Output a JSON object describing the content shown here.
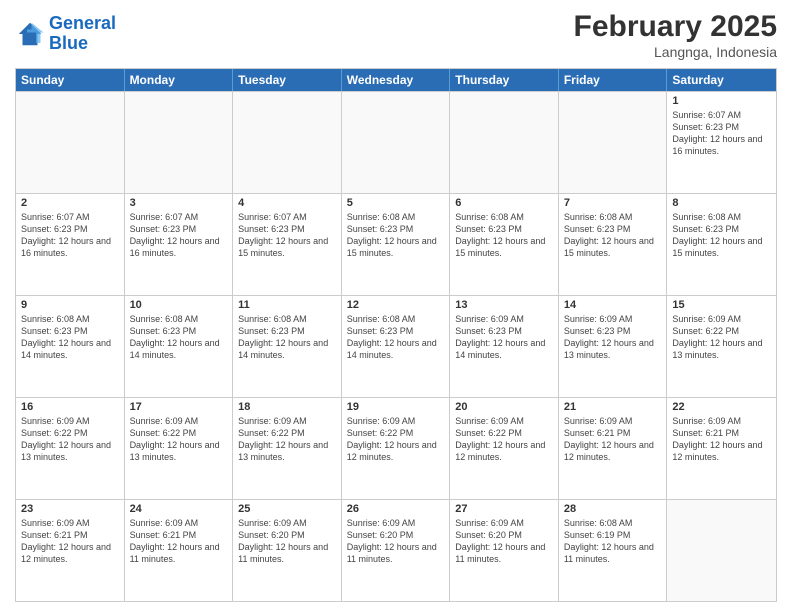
{
  "logo": {
    "line1": "General",
    "line2": "Blue"
  },
  "title": "February 2025",
  "location": "Langnga, Indonesia",
  "day_headers": [
    "Sunday",
    "Monday",
    "Tuesday",
    "Wednesday",
    "Thursday",
    "Friday",
    "Saturday"
  ],
  "weeks": [
    [
      {
        "day": null
      },
      {
        "day": null
      },
      {
        "day": null
      },
      {
        "day": null
      },
      {
        "day": null
      },
      {
        "day": null
      },
      {
        "day": "1",
        "sunrise": "6:07 AM",
        "sunset": "6:23 PM",
        "daylight": "12 hours and 16 minutes."
      }
    ],
    [
      {
        "day": "2",
        "sunrise": "6:07 AM",
        "sunset": "6:23 PM",
        "daylight": "12 hours and 16 minutes."
      },
      {
        "day": "3",
        "sunrise": "6:07 AM",
        "sunset": "6:23 PM",
        "daylight": "12 hours and 16 minutes."
      },
      {
        "day": "4",
        "sunrise": "6:07 AM",
        "sunset": "6:23 PM",
        "daylight": "12 hours and 15 minutes."
      },
      {
        "day": "5",
        "sunrise": "6:08 AM",
        "sunset": "6:23 PM",
        "daylight": "12 hours and 15 minutes."
      },
      {
        "day": "6",
        "sunrise": "6:08 AM",
        "sunset": "6:23 PM",
        "daylight": "12 hours and 15 minutes."
      },
      {
        "day": "7",
        "sunrise": "6:08 AM",
        "sunset": "6:23 PM",
        "daylight": "12 hours and 15 minutes."
      },
      {
        "day": "8",
        "sunrise": "6:08 AM",
        "sunset": "6:23 PM",
        "daylight": "12 hours and 15 minutes."
      }
    ],
    [
      {
        "day": "9",
        "sunrise": "6:08 AM",
        "sunset": "6:23 PM",
        "daylight": "12 hours and 14 minutes."
      },
      {
        "day": "10",
        "sunrise": "6:08 AM",
        "sunset": "6:23 PM",
        "daylight": "12 hours and 14 minutes."
      },
      {
        "day": "11",
        "sunrise": "6:08 AM",
        "sunset": "6:23 PM",
        "daylight": "12 hours and 14 minutes."
      },
      {
        "day": "12",
        "sunrise": "6:08 AM",
        "sunset": "6:23 PM",
        "daylight": "12 hours and 14 minutes."
      },
      {
        "day": "13",
        "sunrise": "6:09 AM",
        "sunset": "6:23 PM",
        "daylight": "12 hours and 14 minutes."
      },
      {
        "day": "14",
        "sunrise": "6:09 AM",
        "sunset": "6:23 PM",
        "daylight": "12 hours and 13 minutes."
      },
      {
        "day": "15",
        "sunrise": "6:09 AM",
        "sunset": "6:22 PM",
        "daylight": "12 hours and 13 minutes."
      }
    ],
    [
      {
        "day": "16",
        "sunrise": "6:09 AM",
        "sunset": "6:22 PM",
        "daylight": "12 hours and 13 minutes."
      },
      {
        "day": "17",
        "sunrise": "6:09 AM",
        "sunset": "6:22 PM",
        "daylight": "12 hours and 13 minutes."
      },
      {
        "day": "18",
        "sunrise": "6:09 AM",
        "sunset": "6:22 PM",
        "daylight": "12 hours and 13 minutes."
      },
      {
        "day": "19",
        "sunrise": "6:09 AM",
        "sunset": "6:22 PM",
        "daylight": "12 hours and 12 minutes."
      },
      {
        "day": "20",
        "sunrise": "6:09 AM",
        "sunset": "6:22 PM",
        "daylight": "12 hours and 12 minutes."
      },
      {
        "day": "21",
        "sunrise": "6:09 AM",
        "sunset": "6:21 PM",
        "daylight": "12 hours and 12 minutes."
      },
      {
        "day": "22",
        "sunrise": "6:09 AM",
        "sunset": "6:21 PM",
        "daylight": "12 hours and 12 minutes."
      }
    ],
    [
      {
        "day": "23",
        "sunrise": "6:09 AM",
        "sunset": "6:21 PM",
        "daylight": "12 hours and 12 minutes."
      },
      {
        "day": "24",
        "sunrise": "6:09 AM",
        "sunset": "6:21 PM",
        "daylight": "12 hours and 11 minutes."
      },
      {
        "day": "25",
        "sunrise": "6:09 AM",
        "sunset": "6:20 PM",
        "daylight": "12 hours and 11 minutes."
      },
      {
        "day": "26",
        "sunrise": "6:09 AM",
        "sunset": "6:20 PM",
        "daylight": "12 hours and 11 minutes."
      },
      {
        "day": "27",
        "sunrise": "6:09 AM",
        "sunset": "6:20 PM",
        "daylight": "12 hours and 11 minutes."
      },
      {
        "day": "28",
        "sunrise": "6:08 AM",
        "sunset": "6:19 PM",
        "daylight": "12 hours and 11 minutes."
      },
      {
        "day": null
      }
    ]
  ]
}
